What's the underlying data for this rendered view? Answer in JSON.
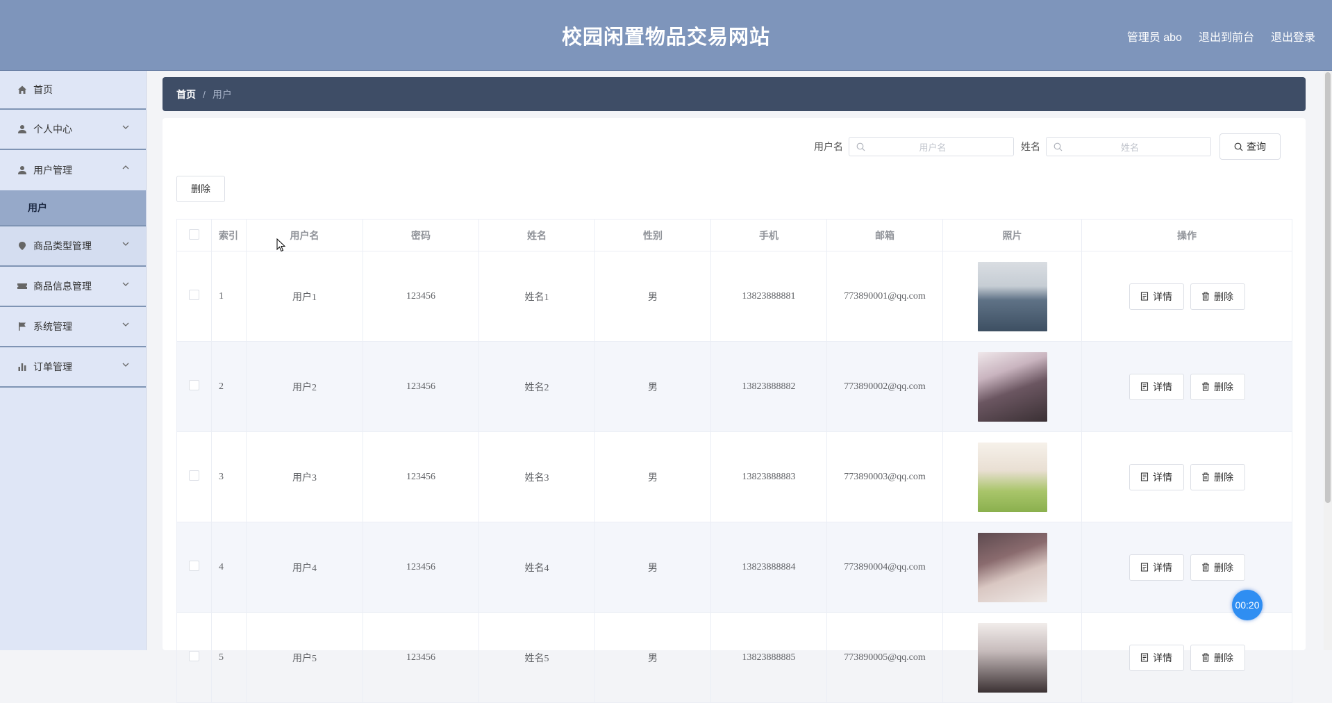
{
  "header": {
    "title": "校园闲置物品交易网站",
    "admin_label": "管理员 abo",
    "to_front_label": "退出到前台",
    "logout_label": "退出登录"
  },
  "sidebar": {
    "items": [
      {
        "label": "首页",
        "icon": "home-icon"
      },
      {
        "label": "个人中心",
        "icon": "user-icon"
      },
      {
        "label": "用户管理",
        "icon": "user-icon",
        "expanded": true
      },
      {
        "label": "商品类型管理",
        "icon": "location-icon"
      },
      {
        "label": "商品信息管理",
        "icon": "ticket-icon"
      },
      {
        "label": "系统管理",
        "icon": "flag-icon"
      },
      {
        "label": "订单管理",
        "icon": "bar-chart-icon"
      }
    ],
    "sub_item": "用户"
  },
  "breadcrumb": {
    "home": "首页",
    "separator": "/",
    "current": "用户"
  },
  "search": {
    "username_label": "用户名",
    "username_placeholder": "用户名",
    "name_label": "姓名",
    "name_placeholder": "姓名",
    "query_label": "查询"
  },
  "toolbar": {
    "delete_label": "删除"
  },
  "table": {
    "columns": [
      "索引",
      "用户名",
      "密码",
      "姓名",
      "性别",
      "手机",
      "邮箱",
      "照片",
      "操作"
    ],
    "detail_label": "详情",
    "delete_label": "删除",
    "rows": [
      {
        "index": "1",
        "username": "用户1",
        "password": "123456",
        "name": "姓名1",
        "gender": "男",
        "phone": "13823888881",
        "email": "773890001@qq.com"
      },
      {
        "index": "2",
        "username": "用户2",
        "password": "123456",
        "name": "姓名2",
        "gender": "男",
        "phone": "13823888882",
        "email": "773890002@qq.com"
      },
      {
        "index": "3",
        "username": "用户3",
        "password": "123456",
        "name": "姓名3",
        "gender": "男",
        "phone": "13823888883",
        "email": "773890003@qq.com"
      },
      {
        "index": "4",
        "username": "用户4",
        "password": "123456",
        "name": "姓名4",
        "gender": "男",
        "phone": "13823888884",
        "email": "773890004@qq.com"
      },
      {
        "index": "5",
        "username": "用户5",
        "password": "123456",
        "name": "姓名5",
        "gender": "男",
        "phone": "13823888885",
        "email": "773890005@qq.com"
      }
    ]
  },
  "timer": "00:20",
  "colors": {
    "header": "#7e95bb",
    "sidebar": "#dfe6f6",
    "breadcrumb": "#3e4d66",
    "timer": "#2f8ef2"
  }
}
